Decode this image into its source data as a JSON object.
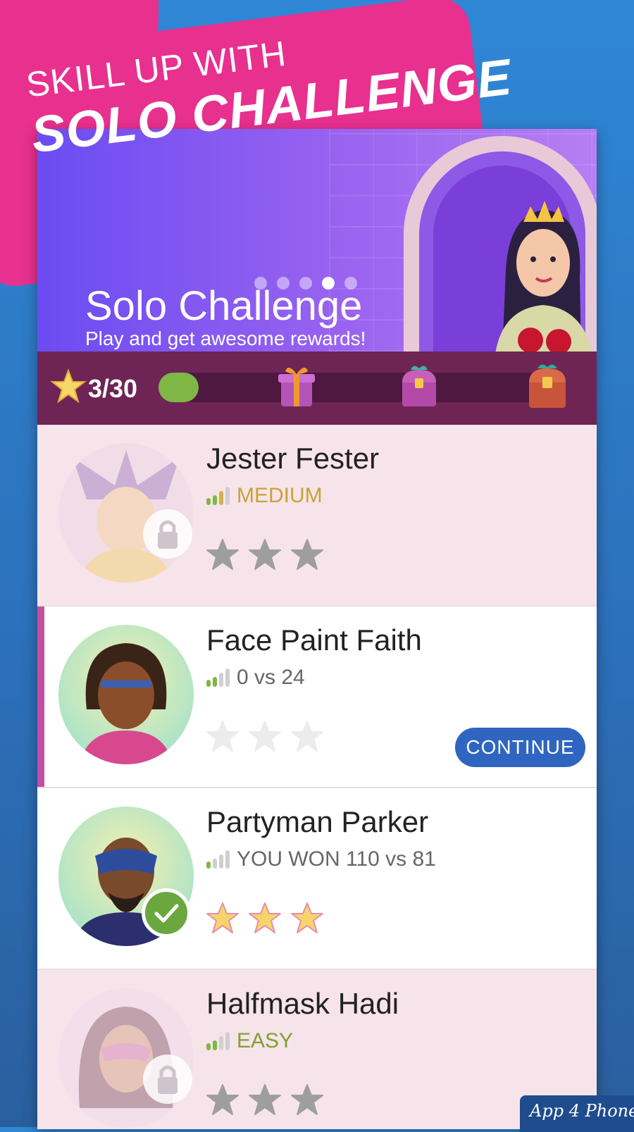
{
  "banner": {
    "line1": "SKILL UP WITH",
    "line2": "SOLO CHALLENGE"
  },
  "hero": {
    "title": "Solo Challenge",
    "subtitle": "Play and get awesome rewards!",
    "carousel_pages": 5,
    "carousel_active_index": 3
  },
  "progress": {
    "score_text": "3/30",
    "value": 3,
    "max": 30,
    "rewards": [
      "gift-box-icon",
      "treasure-chest-icon",
      "large-chest-icon"
    ]
  },
  "challenges": [
    {
      "name": "Jester Fester",
      "status_text": "MEDIUM",
      "status_color": "#c9a235",
      "difficulty_bars": 3,
      "state": "locked",
      "stars_earned": 0
    },
    {
      "name": "Face Paint Faith",
      "status_text": "0 vs 24",
      "status_color": "#666666",
      "difficulty_bars": 2,
      "state": "in-progress",
      "stars_earned": 0,
      "action_label": "CONTINUE"
    },
    {
      "name": "Partyman Parker",
      "status_text": "YOU WON 110 vs 81",
      "status_color": "#666666",
      "difficulty_bars": 1,
      "state": "completed",
      "stars_earned": 3
    },
    {
      "name": "Halfmask Hadi",
      "status_text": "EASY",
      "status_color": "#7ea32f",
      "difficulty_bars": 2,
      "state": "locked",
      "stars_earned": 0
    }
  ],
  "watermark": "App 4 Phone",
  "colors": {
    "banner_pink": "#e8308f",
    "progress_bg": "#6e2556",
    "progress_fill": "#7fb646",
    "continue_button": "#2f65c0",
    "locked_row": "#f7e4ea"
  }
}
